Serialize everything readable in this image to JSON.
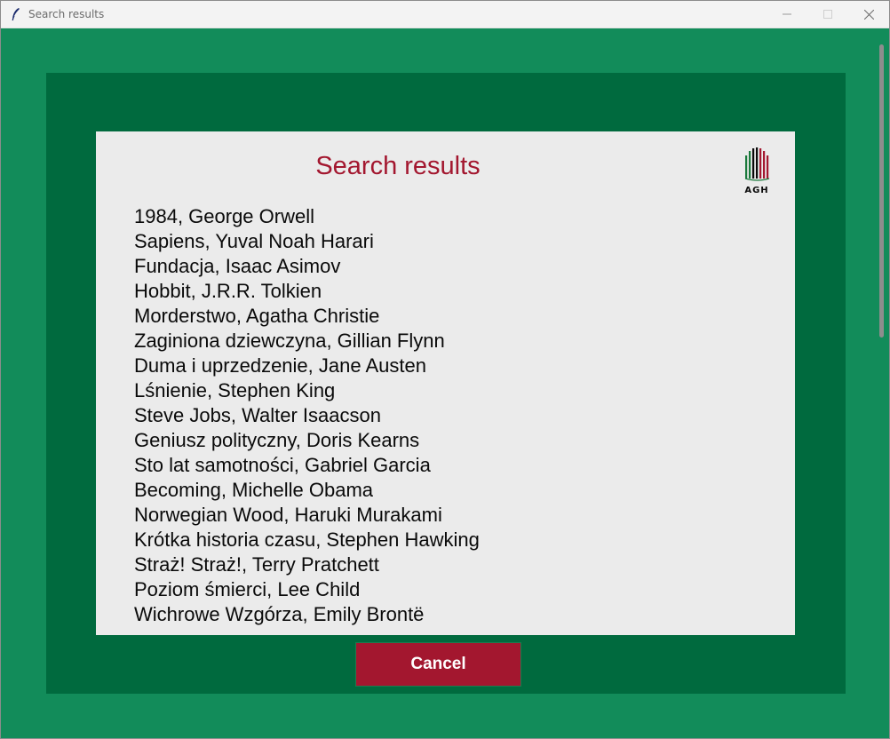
{
  "window": {
    "title": "Search results"
  },
  "panel": {
    "heading": "Search results",
    "logo_text": "AGH"
  },
  "results": [
    "1984, George Orwell",
    "Sapiens, Yuval Noah Harari",
    "Fundacja, Isaac Asimov",
    "Hobbit, J.R.R. Tolkien",
    "Morderstwo, Agatha Christie",
    "Zaginiona dziewczyna, Gillian Flynn",
    "Duma i uprzedzenie, Jane Austen",
    "Lśnienie, Stephen King",
    "Steve Jobs, Walter Isaacson",
    "Geniusz polityczny, Doris Kearns",
    "Sto lat samotności, Gabriel Garcia",
    "Becoming, Michelle Obama",
    "Norwegian Wood, Haruki Murakami",
    "Krótka historia czasu, Stephen Hawking",
    "Straż! Straż!, Terry Pratchett",
    "Poziom śmierci, Lee Child",
    "Wichrowe Wzgórza, Emily Brontë"
  ],
  "buttons": {
    "cancel_label": "Cancel"
  },
  "colors": {
    "background_green": "#128c5a",
    "frame_green": "#006a3e",
    "panel_gray": "#ebebeb",
    "accent_red": "#a3172f",
    "text_black": "#0a0a0a"
  },
  "icons": {
    "app": "feather-icon",
    "minimize": "minimize-icon",
    "maximize": "maximize-icon",
    "close": "close-icon",
    "logo": "agh-logo"
  }
}
